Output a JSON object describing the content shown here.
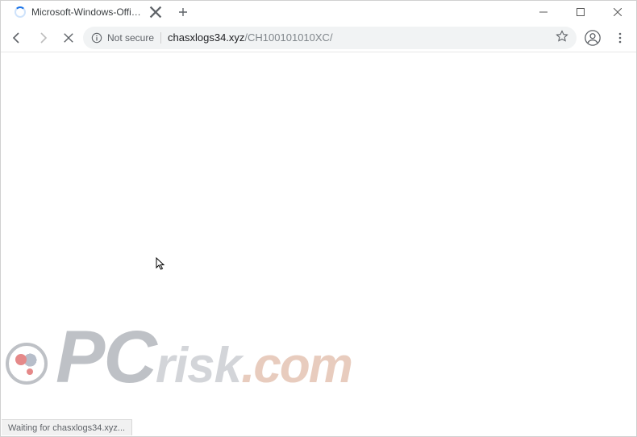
{
  "window": {
    "minimize_tooltip": "Minimize",
    "maximize_tooltip": "Maximize",
    "close_tooltip": "Close"
  },
  "tab": {
    "title": "Microsoft-Windows-Official-Serv",
    "close_tooltip": "Close tab",
    "newtab_tooltip": "New tab"
  },
  "toolbar": {
    "back_tooltip": "Back",
    "forward_tooltip": "Forward",
    "stop_tooltip": "Stop",
    "security_icon_label": "Not secure",
    "security_text": "Not secure",
    "url_host": "chasxlogs34.xyz",
    "url_path": "/CH100101010XC/",
    "star_tooltip": "Bookmark this page",
    "avatar_tooltip": "You",
    "menu_tooltip": "Customize and control"
  },
  "status": {
    "text": "Waiting for chasxlogs34.xyz..."
  },
  "watermark": {
    "part1": "PC",
    "part2": "risk",
    "part3": ".com"
  }
}
